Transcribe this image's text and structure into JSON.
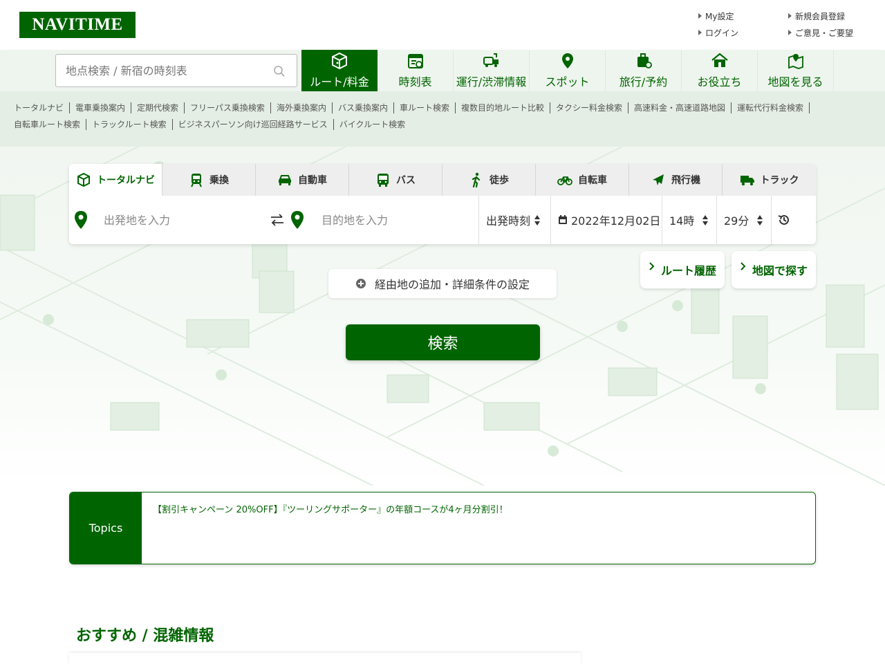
{
  "header": {
    "logo": "NAVITIME",
    "links": [
      "My設定",
      "新規会員登録",
      "ログイン",
      "ご意見・ご要望"
    ]
  },
  "nav": {
    "search_placeholder": "地点検索 / 新宿の時刻表",
    "tabs": [
      {
        "label": "ルート/料金",
        "icon": "route-box-icon",
        "active": true
      },
      {
        "label": "時刻表",
        "icon": "timetable-icon"
      },
      {
        "label": "運行/渋滞情報",
        "icon": "traffic-icon"
      },
      {
        "label": "スポット",
        "icon": "spot-pin-icon"
      },
      {
        "label": "旅行/予約",
        "icon": "suitcase-icon"
      },
      {
        "label": "お役立ち",
        "icon": "house-icon"
      },
      {
        "label": "地図を見る",
        "icon": "map-icon"
      }
    ]
  },
  "sublinks": [
    "トータルナビ",
    "電車乗換案内",
    "定期代検索",
    "フリーパス乗換検索",
    "海外乗換案内",
    "バス乗換案内",
    "車ルート検索",
    "複数目的地ルート比較",
    "タクシー料金検索",
    "高速料金・高速道路地図",
    "運転代行料金検索",
    "自転車ルート検索",
    "トラックルート検索",
    "ビジネスパーソン向け巡回経路サービス",
    "バイクルート検索"
  ],
  "modes": [
    {
      "label": "トータルナビ",
      "icon": "total-navi-icon",
      "active": true
    },
    {
      "label": "乗換",
      "icon": "train-icon"
    },
    {
      "label": "自動車",
      "icon": "car-icon"
    },
    {
      "label": "バス",
      "icon": "bus-icon"
    },
    {
      "label": "徒歩",
      "icon": "walk-icon"
    },
    {
      "label": "自転車",
      "icon": "bicycle-icon"
    },
    {
      "label": "飛行機",
      "icon": "airplane-icon"
    },
    {
      "label": "トラック",
      "icon": "truck-icon"
    }
  ],
  "search": {
    "origin_placeholder": "出発地を入力",
    "destination_placeholder": "目的地を入力",
    "time_type": "出発時刻",
    "date": "2022年12月02日",
    "hour": "14時",
    "minute": "29分"
  },
  "actions": {
    "detail_label": "経由地の追加・詳細条件の設定",
    "history_label": "ルート履歴",
    "map_search_label": "地図で探す",
    "search_label": "検索"
  },
  "topics": {
    "label": "Topics",
    "text": "【割引キャンペーン 20%OFF】『ツーリングサポーター』の年額コースが4ヶ月分割引！"
  },
  "recommend_title": "おすすめ / 混雑情報",
  "colors": {
    "brand": "#006400",
    "nav_bg": "#eef5ee"
  }
}
